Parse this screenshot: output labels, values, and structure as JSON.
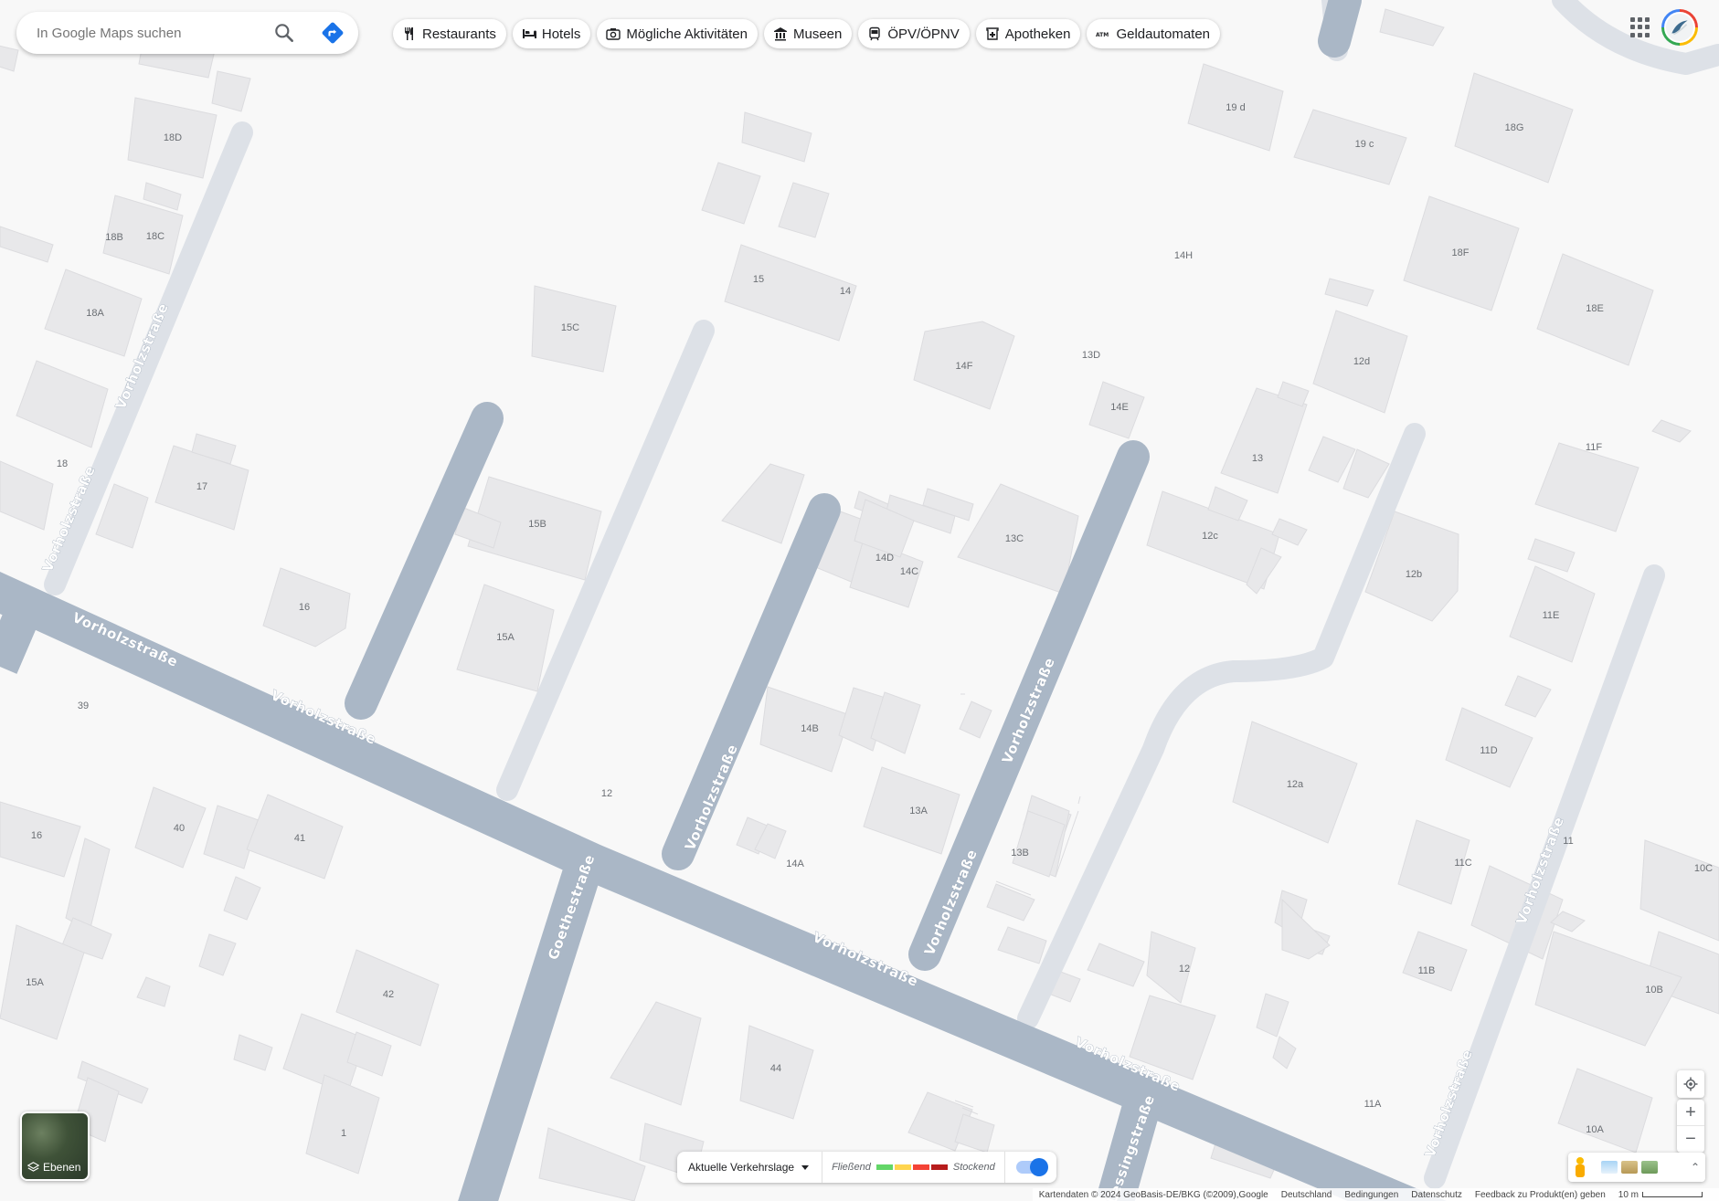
{
  "search": {
    "placeholder": "In Google Maps suchen"
  },
  "chips": [
    {
      "label": "Restaurants",
      "icon": "restaurant-icon"
    },
    {
      "label": "Hotels",
      "icon": "hotel-icon"
    },
    {
      "label": "Mögliche Aktivitäten",
      "icon": "camera-icon"
    },
    {
      "label": "Museen",
      "icon": "museum-icon"
    },
    {
      "label": "ÖPV/ÖPNV",
      "icon": "transit-icon"
    },
    {
      "label": "Apotheken",
      "icon": "pharmacy-icon"
    },
    {
      "label": "Geldautomaten",
      "icon": "atm-icon"
    }
  ],
  "layers": {
    "label": "Ebenen"
  },
  "traffic": {
    "dropdown": "Aktuelle Verkehrslage",
    "legend_fast": "Fließend",
    "legend_slow": "Stockend",
    "colors": [
      "#63d668",
      "#ffd54f",
      "#f44336",
      "#b71c1c"
    ]
  },
  "attribution": {
    "data": "Kartendaten © 2024 GeoBasis-DE/BKG (©2009),Google",
    "country": "Deutschland",
    "terms": "Bedingungen",
    "privacy": "Datenschutz",
    "feedback": "Feedback zu Produkt(en) geben",
    "scale": "10 m"
  },
  "road_labels": [
    "Vorholzstraße",
    "Goethestraße",
    "Lessingstraße"
  ],
  "building_labels": [
    "18D",
    "18B",
    "18C",
    "18A",
    "18",
    "17",
    "16",
    "39",
    "15C",
    "15B",
    "15A",
    "15",
    "14",
    "14F",
    "13D",
    "14E",
    "14H",
    "14D",
    "14C",
    "13C",
    "14B",
    "13A",
    "13B",
    "14A",
    "12",
    "19 d",
    "19 c",
    "18G",
    "18F",
    "18E",
    "12d",
    "11F",
    "13",
    "12c",
    "12b",
    "11E",
    "11D",
    "12a",
    "11C",
    "11",
    "10C",
    "11B",
    "10B",
    "11A",
    "10A",
    "40",
    "41",
    "42",
    "44",
    "1"
  ],
  "colors": {
    "map_bg": "#f8f8f8",
    "building": "#e8e8ea",
    "major_road": "#aab7c6",
    "minor_road": "#dde1e7",
    "accent": "#1a73e8"
  }
}
